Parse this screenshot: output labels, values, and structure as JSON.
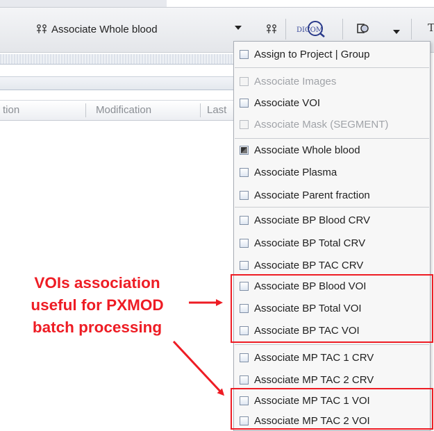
{
  "toolbar": {
    "association_combo": {
      "icon": "association-icon",
      "label": "Associate Whole blood"
    },
    "combo_dropdown_icon": "chevron-down-icon",
    "association_icon": "association-icon",
    "dicom_icon": "dicom-icon",
    "segment_icon": "segment-icon",
    "segment_dropdown_icon": "chevron-down-icon",
    "cut_glyph": "T"
  },
  "table": {
    "columns": [
      "tion",
      "Modification",
      "Last"
    ]
  },
  "menu": {
    "items": [
      {
        "label": "Assign to Project | Group",
        "checked": false,
        "enabled": true
      },
      {
        "label": "Associate Images",
        "checked": false,
        "enabled": false
      },
      {
        "label": "Associate VOI",
        "checked": false,
        "enabled": true
      },
      {
        "label": "Associate Mask (SEGMENT)",
        "checked": false,
        "enabled": false
      },
      {
        "label": "Associate Whole blood",
        "checked": true,
        "enabled": true
      },
      {
        "label": "Associate Plasma",
        "checked": false,
        "enabled": true
      },
      {
        "label": "Associate Parent fraction",
        "checked": false,
        "enabled": true
      },
      {
        "label": "Associate BP Blood CRV",
        "checked": false,
        "enabled": true
      },
      {
        "label": "Associate BP Total CRV",
        "checked": false,
        "enabled": true
      },
      {
        "label": "Associate BP TAC CRV",
        "checked": false,
        "enabled": true
      },
      {
        "label": "Associate BP Blood VOI",
        "checked": false,
        "enabled": true
      },
      {
        "label": "Associate BP Total VOI",
        "checked": false,
        "enabled": true
      },
      {
        "label": "Associate BP TAC VOI",
        "checked": false,
        "enabled": true
      },
      {
        "label": "Associate MP TAC 1 CRV",
        "checked": false,
        "enabled": true
      },
      {
        "label": "Associate MP TAC 2 CRV",
        "checked": false,
        "enabled": true
      },
      {
        "label": "Associate MP TAC 1 VOI",
        "checked": false,
        "enabled": true
      },
      {
        "label": "Associate MP TAC 2 VOI",
        "checked": false,
        "enabled": true
      }
    ]
  },
  "annotation": {
    "lines": [
      "VOIs association",
      "useful for PXMOD",
      "batch processing"
    ],
    "color": "#ee1c24"
  }
}
